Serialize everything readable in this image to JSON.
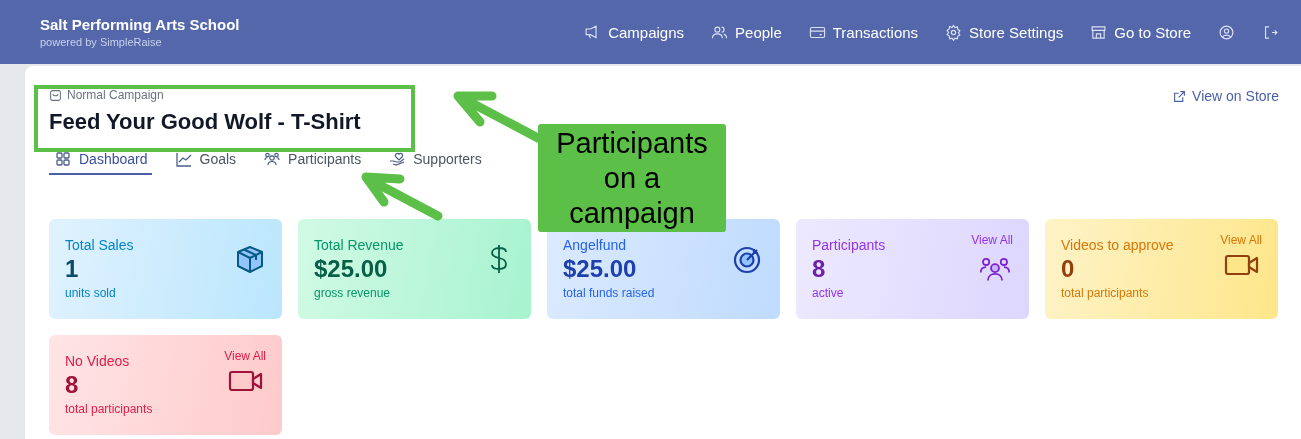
{
  "header": {
    "title": "Salt Performing Arts School",
    "subtitle": "powered by SimpleRaise",
    "nav": [
      {
        "kind": "megaphone",
        "label": "Campaigns"
      },
      {
        "kind": "people",
        "label": "People"
      },
      {
        "kind": "card",
        "label": "Transactions"
      },
      {
        "kind": "gear",
        "label": "Store Settings"
      },
      {
        "kind": "store",
        "label": "Go to Store"
      },
      {
        "kind": "user"
      },
      {
        "kind": "logout"
      }
    ]
  },
  "campaign": {
    "type": "Normal Campaign",
    "title": "Feed Your Good Wolf - T-Shirt",
    "view_link": "View on Store"
  },
  "tabs": [
    {
      "kind": "grid",
      "label": "Dashboard",
      "selected": true
    },
    {
      "kind": "chart",
      "label": "Goals",
      "selected": false
    },
    {
      "kind": "people",
      "label": "Participants",
      "selected": false
    },
    {
      "kind": "hand",
      "label": "Supporters",
      "selected": false
    }
  ],
  "cards": [
    {
      "kind": "box",
      "color": "#0284c7",
      "label": "Total Sales",
      "value": "1",
      "caption": "units sold"
    },
    {
      "kind": "dollar",
      "color": "#059669",
      "label": "Total Revenue",
      "value": "$25.00",
      "caption": "gross revenue"
    },
    {
      "kind": "target",
      "color": "#2563eb",
      "label": "Angelfund",
      "value": "$25.00",
      "caption": "total funds raised"
    },
    {
      "kind": "people",
      "color": "#9333ea",
      "label": "Participants",
      "value": "8",
      "caption": "active",
      "link": "View All"
    },
    {
      "kind": "video",
      "color": "#d97706",
      "label": "Videos to approve",
      "value": "0",
      "caption": "total participants",
      "link": "View All"
    },
    {
      "kind": "video",
      "color": "#e11d48",
      "label": "No Videos",
      "value": "8",
      "caption": "total participants",
      "link": "View All"
    }
  ],
  "annotation": {
    "callout": "Participants on a campaign"
  }
}
